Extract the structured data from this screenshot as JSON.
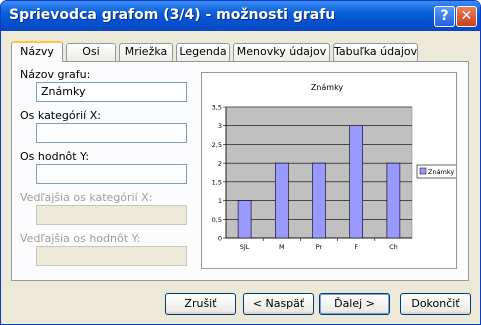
{
  "window": {
    "title": "Sprievodca grafom (3/4) - možnosti grafu",
    "help_glyph": "?",
    "close_glyph": "✕"
  },
  "tabs": [
    {
      "label": "Názvy",
      "active": true
    },
    {
      "label": "Osi"
    },
    {
      "label": "Mriežka"
    },
    {
      "label": "Legenda"
    },
    {
      "label": "Menovky údajov"
    },
    {
      "label": "Tabuľka údajov"
    }
  ],
  "form": {
    "chart_title_label": "Názov grafu:",
    "chart_title_value": "Známky",
    "x_axis_label": "Os kategórií X:",
    "x_axis_value": "",
    "y_axis_label": "Os hodnôt Y:",
    "y_axis_value": "",
    "secondary_x_label": "Vedľajšia os kategórií X:",
    "secondary_y_label": "Vedľajšia os hodnôt Y:"
  },
  "buttons": {
    "cancel": "Zrušiť",
    "back": "< Naspäť",
    "next": "Ďalej >",
    "finish": "Dokončiť"
  },
  "colors": {
    "bar": "#9999ff",
    "plot_area": "#c0c0c0"
  },
  "chart_data": {
    "type": "bar",
    "title": "Známky",
    "categories": [
      "SJL",
      "M",
      "Pr",
      "F",
      "Ch"
    ],
    "series": [
      {
        "name": "Známky",
        "values": [
          1,
          2,
          2,
          3,
          2
        ]
      }
    ],
    "ylim": [
      0,
      3.5
    ],
    "yticks": [
      "0",
      "0,5",
      "1",
      "1,5",
      "2",
      "2,5",
      "3",
      "3,5"
    ],
    "grid": true,
    "legend": "right"
  }
}
